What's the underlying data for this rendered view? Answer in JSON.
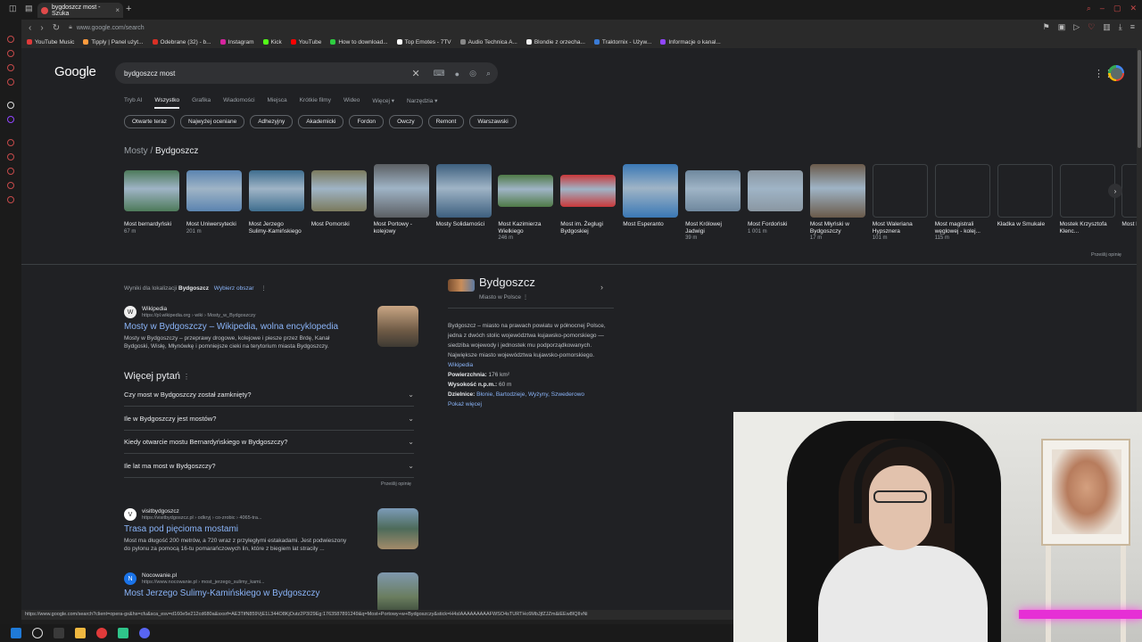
{
  "browser": {
    "tab_title": "bygdoszcz most - Szuka",
    "url": "www.google.com/search",
    "status_url": "https://www.google.com/search?client=opera-gx&hs=cfu&sca_esv=d160e5e212cd680a&sxsrf=AE3TifN859VjE1L344O8KjOutz2P3I29Eg:1763587891249&q=Most+Portowy+w+Bydgoszczy&stick=H4sIAAAAAAAAAFWSO4sTURTHc6MbJjfZJZm&iEEw8IQIIvNi",
    "bookmarks": [
      {
        "label": "YouTube Music",
        "color": "#e03a3a"
      },
      {
        "label": "Tipply | Panel użyt...",
        "color": "#ff9b3d"
      },
      {
        "label": "Odebrane (32) - b...",
        "color": "#d93025"
      },
      {
        "label": "Instagram",
        "color": "#d6249f"
      },
      {
        "label": "Kick",
        "color": "#53fc18"
      },
      {
        "label": "YouTube",
        "color": "#ff0000"
      },
      {
        "label": "How to download...",
        "color": "#2ecc40"
      },
      {
        "label": "Top Emotes - 7TV",
        "color": "#ffffff"
      },
      {
        "label": "Audio Technica A...",
        "color": "#888888"
      },
      {
        "label": "Blondie z orzecha...",
        "color": "#f0f0f0"
      },
      {
        "label": "Traktornix - Używ...",
        "color": "#3a7bd5"
      },
      {
        "label": "Informacje o kanal...",
        "color": "#9146ff"
      }
    ]
  },
  "search": {
    "logo": "Google",
    "query": "bydgoszcz most",
    "modes": [
      "Tryb AI",
      "Wszystko",
      "Grafika",
      "Wiadomości",
      "Miejsca",
      "Krótkie filmy",
      "Wideo",
      "Więcej ▾",
      "Narzędzia ▾"
    ],
    "active_mode": "Wszystko",
    "chips": [
      "Otwarte teraz",
      "Najwyżej oceniane",
      "Adhezyjny",
      "Akademicki",
      "Fordon",
      "Owczy",
      "Remont",
      "Warszawski"
    ]
  },
  "carousel": {
    "breadcrumb_a": "Mosty",
    "breadcrumb_sep": " / ",
    "breadcrumb_b": "Bydgoszcz",
    "items": [
      {
        "name": "Most bernardyński",
        "dist": "67 m",
        "color": "#4d7a5a"
      },
      {
        "name": "Most Uniwersytecki",
        "dist": "201 m",
        "color": "#5b84b0"
      },
      {
        "name": "Most Jerzego Sulimy-Kamińskiego",
        "dist": "",
        "color": "#3f6e8f"
      },
      {
        "name": "Most Pomorski",
        "dist": "",
        "color": "#7b7a5d"
      },
      {
        "name": "Most Portowy - kolejowy",
        "dist": "",
        "color": "#5c5f63"
      },
      {
        "name": "Mosty Solidarności",
        "dist": "",
        "color": "#3d5f7e"
      },
      {
        "name": "Most Kazimierza Wielkiego",
        "dist": "246 m",
        "color": "#4f7a47"
      },
      {
        "name": "Most im. Żeglugi Bydgoskiej",
        "dist": "",
        "color": "#c9383a"
      },
      {
        "name": "Most Esperanto",
        "dist": "",
        "color": "#3a78b5"
      },
      {
        "name": "Most Królowej Jadwigi",
        "dist": "39 m",
        "color": "#6f889e"
      },
      {
        "name": "Most Fordoński",
        "dist": "1 001 m",
        "color": "#8a97a2"
      },
      {
        "name": "Most Młyński w Bydgoszczy",
        "dist": "17 m",
        "color": "#6a5a4a"
      },
      {
        "name": "Most Waleriana Hypsznera",
        "dist": "101 m",
        "color": "#202124"
      },
      {
        "name": "Most magistrali węglowej - kolej...",
        "dist": "115 m",
        "color": "#202124"
      },
      {
        "name": "Kładka w Smukale",
        "dist": "",
        "color": "#202124"
      },
      {
        "name": "Mostek Krzysztofa Klenc...",
        "dist": "",
        "color": "#202124"
      },
      {
        "name": "Most Klepi...",
        "dist": "",
        "color": "#202124"
      }
    ],
    "feedback": "Prześlij opinię"
  },
  "results": {
    "location_prefix": "Wyniki dla lokalizacji",
    "location_name": "Bydgoszcz",
    "location_link": "Wybierz obszar",
    "items": [
      {
        "favicon": "W",
        "site": "Wikipedia",
        "url": "https://pl.wikipedia.org › wiki › Mosty_w_Bydgoszczy",
        "title": "Mosty w Bydgoszczy – Wikipedia, wolna encyklopedia",
        "snippet": "Mosty w Bydgoszczy – przeprawy drogowe, kolejowe i piesze przez Brdę, Kanał Bydgoski, Wisłę, Młynówkę i pomniejsze cieki na terytorium miasta Bydgoszczy."
      },
      {
        "favicon": "V",
        "site": "visitbydgoszcz",
        "url": "https://visitbydgoszcz.pl › odkryj › co-zrobic › 4065-tra...",
        "title": "Trasa pod pięcioma mostami",
        "snippet": "Most ma długość 200 metrów, a 720 wraz z przyległymi estakadami. Jest podwieszony do pylonu za pomocą 16-tu pomarańczowych lin, które z biegiem lat stracily ..."
      },
      {
        "favicon": "N",
        "site": "Nocowanie.pl",
        "url": "https://www.nocowanie.pl › most_jerzego_sulimy_kami...",
        "title": "Most Jerzego Sulimy-Kamińskiego w Bydgoszczy",
        "snippet": ""
      }
    ]
  },
  "paa": {
    "title": "Więcej pytań",
    "questions": [
      "Czy most w Bydgoszczy został zamknięty?",
      "Ile w Bydgoszczy jest mostów?",
      "Kiedy otwarcie mostu Bernardyńskiego w Bydgoszczy?",
      "Ile lat ma most w Bydgoszczy?"
    ],
    "feedback": "Prześlij opinię"
  },
  "knowledge_panel": {
    "title": "Bydgoszcz",
    "subtitle": "Miasto w Polsce",
    "description": "Bydgoszcz – miasto na prawach powiatu w północnej Polsce, jedna z dwóch stolic województwa kujawsko-pomorskiego — siedziba wojewody i jednostek mu podporządkowanych. Największe miasto województwa kujawsko-pomorskiego.",
    "source_link": "Wikipedia",
    "area_label": "Powierzchnia:",
    "area_value": "176 km²",
    "elevation_label": "Wysokość n.p.m.:",
    "elevation_value": "60 m",
    "districts_label": "Dzielnice:",
    "districts_value": "Błonie, Bartodzieje, Wyżyny, Szwederowo",
    "more_link": "Pokaż więcej"
  }
}
